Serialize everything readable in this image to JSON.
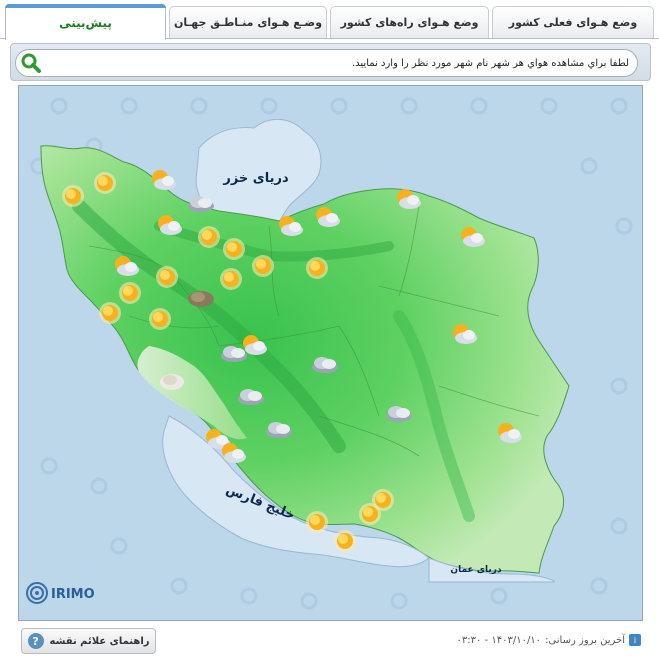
{
  "tabs": [
    {
      "label": "وضع هـواى فعلى كشور"
    },
    {
      "label": "وضع هـواى راه‌های كشور"
    },
    {
      "label": "وضـع هـواى منـاطـق جهـان"
    },
    {
      "label": "پيش‌بينى"
    }
  ],
  "search": {
    "placeholder": "لطفا براي مشاهده هواي هر شهر نام شهر مورد نظر را وارد نماييد."
  },
  "map": {
    "labels": {
      "caspian": "درياى خزر",
      "gulf": "خليج فارس",
      "oman": "درياى عمان"
    },
    "logo": "IRIMO",
    "colors": {
      "sea": "#bcd6ea",
      "land_light": "#b5e6a6",
      "land_mid": "#6fd26b",
      "land_dark": "#35b84a"
    },
    "weather_icons": [
      {
        "icon": "sun-icon"
      },
      {
        "icon": "sun-icon"
      },
      {
        "icon": "partly-cloudy-icon"
      },
      {
        "icon": "cloudy-icon"
      },
      {
        "icon": "partly-cloudy-icon"
      },
      {
        "icon": "sun-icon"
      },
      {
        "icon": "sun-icon"
      },
      {
        "icon": "partly-cloudy-icon"
      },
      {
        "icon": "partly-cloudy-icon"
      },
      {
        "icon": "partly-cloudy-icon"
      },
      {
        "icon": "partly-cloudy-icon"
      },
      {
        "icon": "sun-icon"
      },
      {
        "icon": "sun-icon"
      },
      {
        "icon": "sun-icon"
      },
      {
        "icon": "sun-icon"
      },
      {
        "icon": "partly-cloudy-icon"
      },
      {
        "icon": "sun-icon"
      },
      {
        "icon": "dust-icon"
      },
      {
        "icon": "sun-icon"
      },
      {
        "icon": "sun-icon"
      },
      {
        "icon": "partly-cloudy-icon"
      },
      {
        "icon": "cloudy-icon"
      },
      {
        "icon": "partly-cloudy-icon"
      },
      {
        "icon": "fog-icon"
      },
      {
        "icon": "cloudy-icon"
      },
      {
        "icon": "cloudy-icon"
      },
      {
        "icon": "cloudy-icon"
      },
      {
        "icon": "partly-cloudy-icon"
      },
      {
        "icon": "partly-cloudy-icon"
      },
      {
        "icon": "partly-cloudy-icon"
      },
      {
        "icon": "sun-icon"
      },
      {
        "icon": "sun-icon"
      },
      {
        "icon": "sun-icon"
      },
      {
        "icon": "sun-icon"
      },
      {
        "icon": "partly-cloudy-icon"
      }
    ]
  },
  "footer": {
    "legend_button": "راهنماى علائم نقشه",
    "last_update_label": "آخرين بروز رسانى:",
    "last_update_value": "۱۴۰۳/۱۰/۱۰ - ۰۳:۳۰"
  }
}
